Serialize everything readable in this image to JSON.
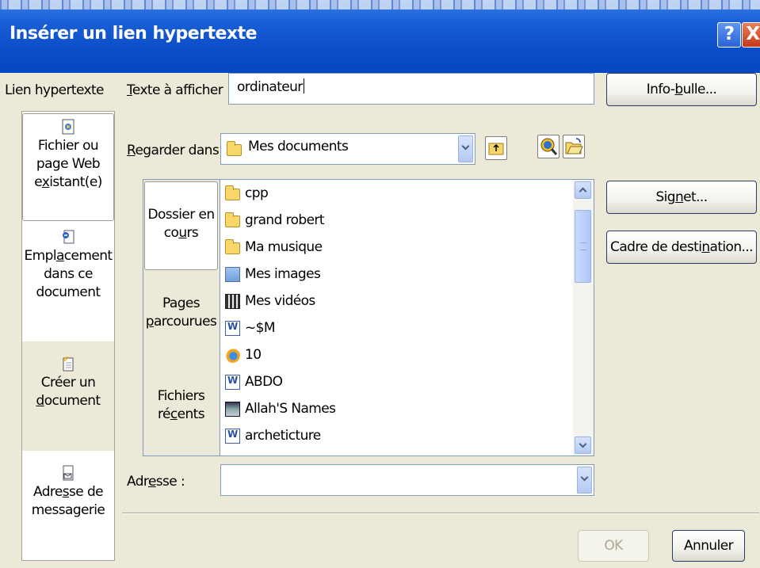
{
  "dialog": {
    "title": "Insérer un lien hypertexte",
    "help_label": "?",
    "close_label": "X"
  },
  "link_to": {
    "heading": "Lien hypertexte",
    "items": [
      {
        "line1": "Fichier ou",
        "line2": "page Web",
        "line3_pre": "e",
        "line3_u": "x",
        "line3_post": "istant(e)"
      },
      {
        "line1_pre": "Empl",
        "line1_u": "a",
        "line1_post": "cement",
        "line2": "dans ce",
        "line3": "document"
      },
      {
        "line1": "Créer un",
        "line2_u": "d",
        "line2_post": "ocument"
      },
      {
        "line1_pre": "Adre",
        "line1_u": "s",
        "line1_post": "se de",
        "line2": "messagerie"
      }
    ]
  },
  "text_to_display": {
    "label_u": "T",
    "label_post": "exte à afficher :",
    "value": "ordinateur"
  },
  "tooltip_button": {
    "pre": "Info-",
    "u": "b",
    "post": "ulle..."
  },
  "look_in": {
    "label_u": "R",
    "label_post": "egarder dans :",
    "value": "Mes documents"
  },
  "shortcuts": [
    {
      "line1": "Dossier en",
      "line2_pre": "co",
      "line2_u": "u",
      "line2_post": "rs"
    },
    {
      "line1": "Pages",
      "line2_u": "p",
      "line2_post": "arcourues"
    },
    {
      "line1": "Fichiers",
      "line2_pre": "ré",
      "line2_u": "c",
      "line2_post": "ents"
    }
  ],
  "files": [
    {
      "name": "cpp",
      "icon": "folder-icon"
    },
    {
      "name": "grand robert",
      "icon": "folder-icon"
    },
    {
      "name": "Ma musique",
      "icon": "folder-icon"
    },
    {
      "name": "Mes images",
      "icon": "pictures-folder-icon"
    },
    {
      "name": "Mes vidéos",
      "icon": "videos-folder-icon"
    },
    {
      "name": "~$M",
      "icon": "word-document-icon"
    },
    {
      "name": "10",
      "icon": "media-file-icon"
    },
    {
      "name": "ABDO",
      "icon": "word-document-icon"
    },
    {
      "name": "Allah'S Names",
      "icon": "application-icon"
    },
    {
      "name": "archeticture",
      "icon": "word-document-icon"
    }
  ],
  "bookmark_button": {
    "pre": "Sig",
    "u": "n",
    "post": "et..."
  },
  "target_frame_button": {
    "pre": "Cadre de desti",
    "u": "n",
    "post": "ation..."
  },
  "address": {
    "label_pre": "Adr",
    "label_u": "e",
    "label_post": "sse :",
    "value": ""
  },
  "ok_label": "OK",
  "cancel_label": "Annuler"
}
